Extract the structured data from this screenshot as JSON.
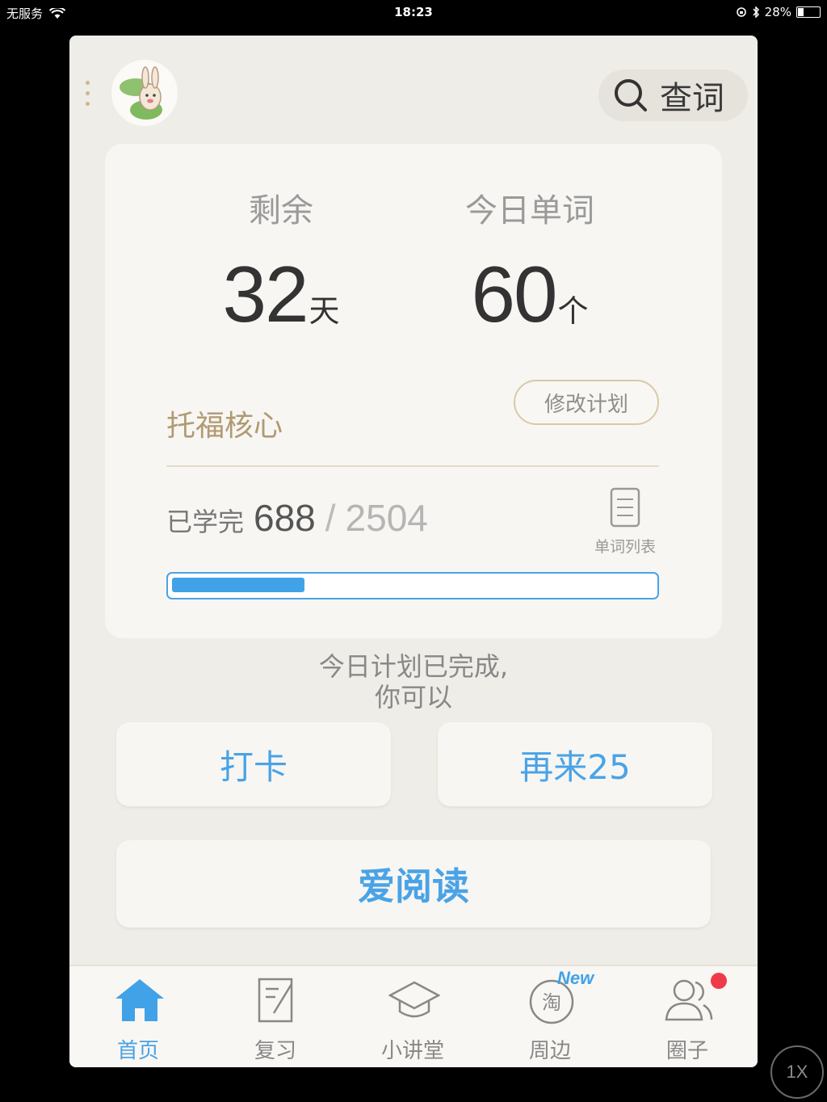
{
  "status_bar": {
    "carrier": "无服务",
    "time": "18:23",
    "battery": "28%",
    "battery_level": 0.28
  },
  "header": {
    "search_label": "查词"
  },
  "stats": {
    "remaining_label": "剩余",
    "remaining_value": "32",
    "remaining_unit": "天",
    "today_label": "今日单词",
    "today_value": "60",
    "today_unit": "个"
  },
  "plan": {
    "name": "托福核心",
    "modify_label": "修改计划"
  },
  "progress": {
    "learned_label": "已学完",
    "learned": "688",
    "separator": "/",
    "total": "2504",
    "fraction": 0.275,
    "wordlist_label": "单词列表"
  },
  "complete_message": {
    "line1": "今日计划已完成,",
    "line2": "你可以"
  },
  "actions": {
    "checkin": "打卡",
    "again": "再来25",
    "read": "爱阅读"
  },
  "tabs": [
    {
      "label": "首页",
      "icon": "home-icon",
      "active": true
    },
    {
      "label": "复习",
      "icon": "review-icon"
    },
    {
      "label": "小讲堂",
      "icon": "graduation-cap-icon"
    },
    {
      "label": "周边",
      "icon": "taobao-icon",
      "badge": "New"
    },
    {
      "label": "圈子",
      "icon": "group-icon",
      "dot": true
    }
  ],
  "zoom_label": "1X",
  "colors": {
    "accent": "#4aa3e6",
    "plan": "#b09a72",
    "badge": "#ef3a4a"
  }
}
